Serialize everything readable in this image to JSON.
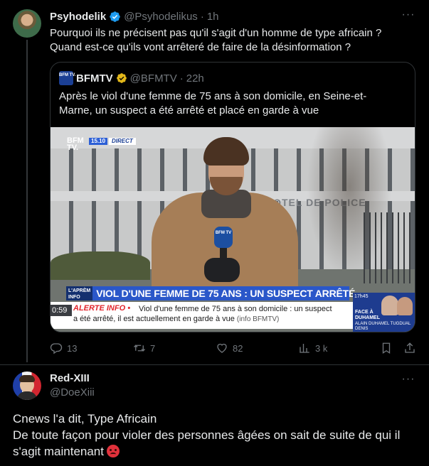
{
  "tweet1": {
    "author_name": "Psyhodelik",
    "handle": "@Psyhodelikus",
    "separator": "·",
    "time": "1h",
    "more_label": "···",
    "text_line1": "Pourquoi ils ne précisent pas qu'il s'agit d'un homme de type africain ?",
    "text_line2": "Quand est-ce qu'ils vont arrêteré de faire de la désinformation ?",
    "stats": {
      "replies": "13",
      "retweets": "7",
      "likes": "82",
      "views": "3 k"
    }
  },
  "quote": {
    "logo_text": "BFM TV.",
    "author_name": "BFMTV",
    "handle": "@BFMTV",
    "separator": "·",
    "time": "22h",
    "text": "Après le viol d'une femme de 75 ans à son domicile, en Seine-et-Marne, un suspect a été arrêté et placé en garde à vue",
    "media": {
      "channel_logo": "BFM TV.",
      "clock": "15.10",
      "live_tag": "DIRECT",
      "mic_logo": "BFM TV",
      "building_sign": "HOTEL DE POLICE",
      "banner_tag": "L'APRÈM INFO",
      "banner_title": "VIOL D'UNE FEMME DE 75 ANS : UN SUSPECT ARRÊTÉ",
      "ticker_time": "0:59",
      "ticker_alert": "ALERTE INFO •",
      "ticker_line1": "Viol d'une femme de 75 ans à son domicile : un suspect",
      "ticker_line2": "a été arrêté, il est actuellement en garde à vue",
      "ticker_source": "(info BFMTV)",
      "promo_time": "17h45",
      "promo_title": "FACE À DUHAMEL",
      "promo_names": "ALAIN DUHAMEL TUGDUAL DENIS"
    }
  },
  "tweet2": {
    "author_name": "Red-XIII",
    "handle": "@DoeXiii",
    "more_label": "···",
    "text_line1": "Cnews l'a dit, Type Africain",
    "text_line2": "De toute façon pour violer des personnes âgées on sait de suite de qui il",
    "text_line3": "s'agit maintenant"
  },
  "icons": {
    "verified": "verified-badge-icon",
    "reply": "reply-icon",
    "retweet": "retweet-icon",
    "like": "heart-icon",
    "views": "views-icon",
    "bookmark": "bookmark-icon",
    "share": "share-icon",
    "more": "more-icon",
    "emoji": "angry-face-emoji"
  },
  "colors": {
    "background": "#000000",
    "text_primary": "#e7e9ea",
    "text_secondary": "#71767b",
    "border": "#2f3336",
    "verified_gold": "#e2b719",
    "bfm_blue": "#2a57c9"
  }
}
